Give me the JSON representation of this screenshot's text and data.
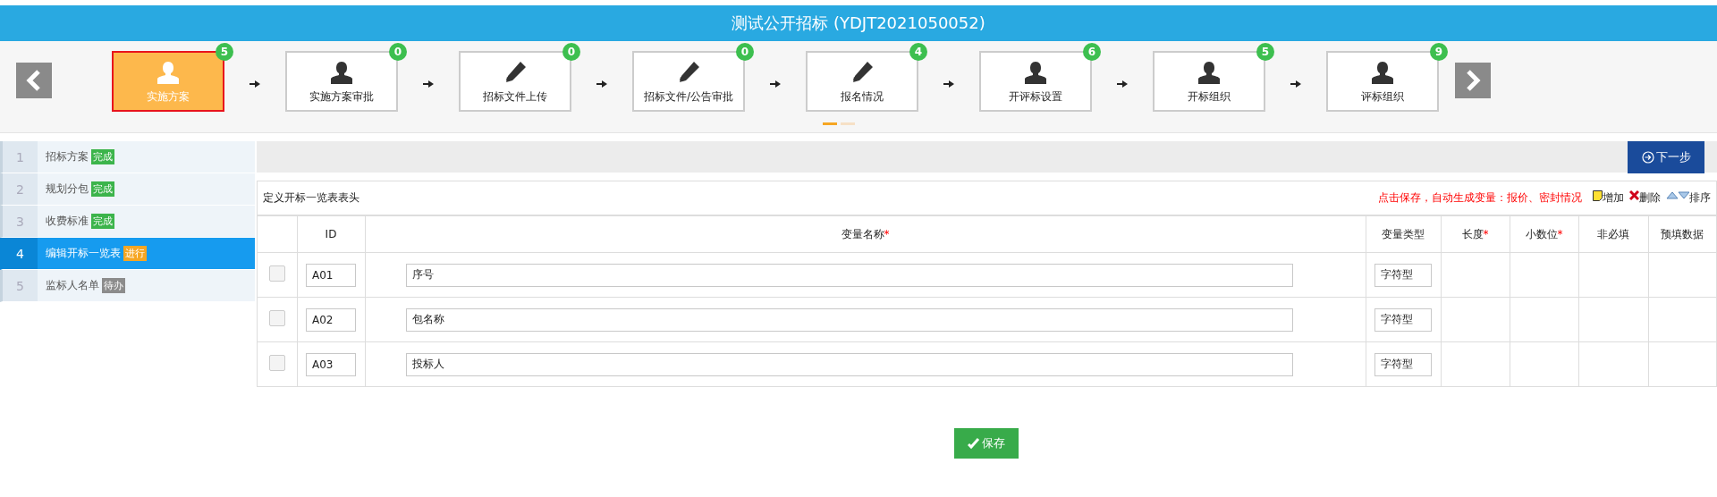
{
  "title": "测试公开招标 (YDJT2021050052)",
  "steps": [
    {
      "label": "实施方案",
      "kind": "person",
      "badge": "5",
      "selected": true
    },
    {
      "label": "实施方案审批",
      "kind": "person",
      "badge": "0",
      "selected": false
    },
    {
      "label": "招标文件上传",
      "kind": "edit",
      "badge": "0",
      "selected": false
    },
    {
      "label": "招标文件/公告审批",
      "kind": "edit",
      "badge": "0",
      "selected": false
    },
    {
      "label": "报名情况",
      "kind": "edit",
      "badge": "4",
      "selected": false
    },
    {
      "label": "开评标设置",
      "kind": "person",
      "badge": "6",
      "selected": false
    },
    {
      "label": "开标组织",
      "kind": "person",
      "badge": "5",
      "selected": false
    },
    {
      "label": "评标组织",
      "kind": "person",
      "badge": "9",
      "selected": false
    }
  ],
  "pager": [
    {
      "selected": true
    },
    {
      "selected": false
    }
  ],
  "sidebar": [
    {
      "num": "1",
      "label": "招标方案",
      "status": "完成",
      "kind": "done",
      "selected": false
    },
    {
      "num": "2",
      "label": "规划分包",
      "status": "完成",
      "kind": "done",
      "selected": false
    },
    {
      "num": "3",
      "label": "收费标准",
      "status": "完成",
      "kind": "done",
      "selected": false
    },
    {
      "num": "4",
      "label": "编辑开标一览表",
      "status": "进行",
      "kind": "doing",
      "selected": true
    },
    {
      "num": "5",
      "label": "监标人名单",
      "status": "待办",
      "kind": "todo",
      "selected": false
    }
  ],
  "next_button": "下一步",
  "table_caption": "定义开标一览表表头",
  "hint": "点击保存，自动生成变量：报价、密封情况",
  "actions": {
    "add": "增加",
    "delete": "删除",
    "sort": "排序"
  },
  "columns": [
    {
      "label": "ID"
    },
    {
      "label": "变量名称",
      "required_mark": "*"
    },
    {
      "label": "变量类型"
    },
    {
      "label": "长度",
      "required_mark": "*"
    },
    {
      "label": "小数位",
      "required_mark": "*"
    },
    {
      "label": "非必填"
    },
    {
      "label": "预填数据"
    }
  ],
  "rows": [
    {
      "checked": false,
      "id": "A01",
      "name": "序号",
      "type": "字符型"
    },
    {
      "checked": false,
      "id": "A02",
      "name": "包名称",
      "type": "字符型"
    },
    {
      "checked": false,
      "id": "A03",
      "name": "投标人",
      "type": "字符型"
    }
  ],
  "save_button": "保存"
}
